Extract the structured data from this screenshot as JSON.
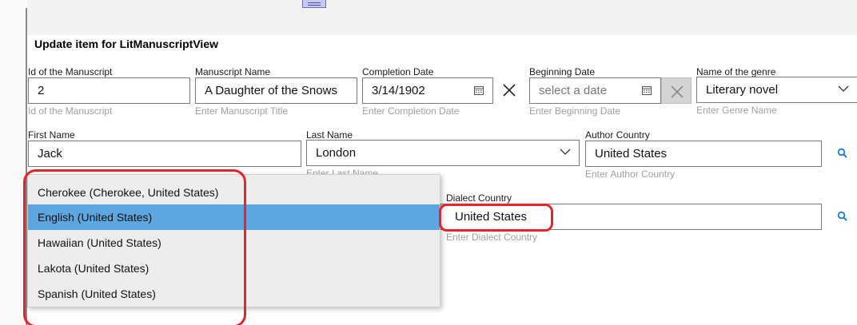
{
  "form": {
    "title": "Update item for LitManuscriptView",
    "fields": {
      "id": {
        "label": "Id of the Manuscript",
        "value": "2",
        "hint": "Id of the Manuscript"
      },
      "name": {
        "label": "Manuscript Name",
        "value": "A Daughter of the Snows",
        "hint": "Enter Manuscript Title"
      },
      "completion": {
        "label": "Completion Date",
        "value": "3/14/1902",
        "hint": "Enter Completion Date"
      },
      "beginning": {
        "label": "Beginning Date",
        "placeholder": "select a date",
        "hint": "Enter Beginning Date"
      },
      "genre": {
        "label": "Name of the genre",
        "value": "Literary novel",
        "hint": "Enter Genre Name"
      },
      "first_name": {
        "label": "First Name",
        "value": "Jack"
      },
      "last_name": {
        "label": "Last Name",
        "value": "London",
        "hint": "Enter Last Name"
      },
      "author_country": {
        "label": "Author Country",
        "value": "United States",
        "hint": "Enter Author Country"
      },
      "dialect_country": {
        "label": "Dialect Country",
        "value": "United States",
        "hint": "Enter Dialect Country"
      }
    }
  },
  "dialect_dropdown": {
    "options": [
      "Cherokee (Cherokee, United States)",
      "English (United States)",
      "Hawaiian (United States)",
      "Lakota (United States)",
      "Spanish (United States)"
    ],
    "selected": "English (United States)"
  },
  "colors": {
    "selection": "#5ea6e0",
    "annotation": "#e3242b",
    "search_icon": "#1e7bd6"
  },
  "icons": [
    "calendar-icon",
    "close-icon",
    "chevron-down-icon",
    "search-icon"
  ]
}
